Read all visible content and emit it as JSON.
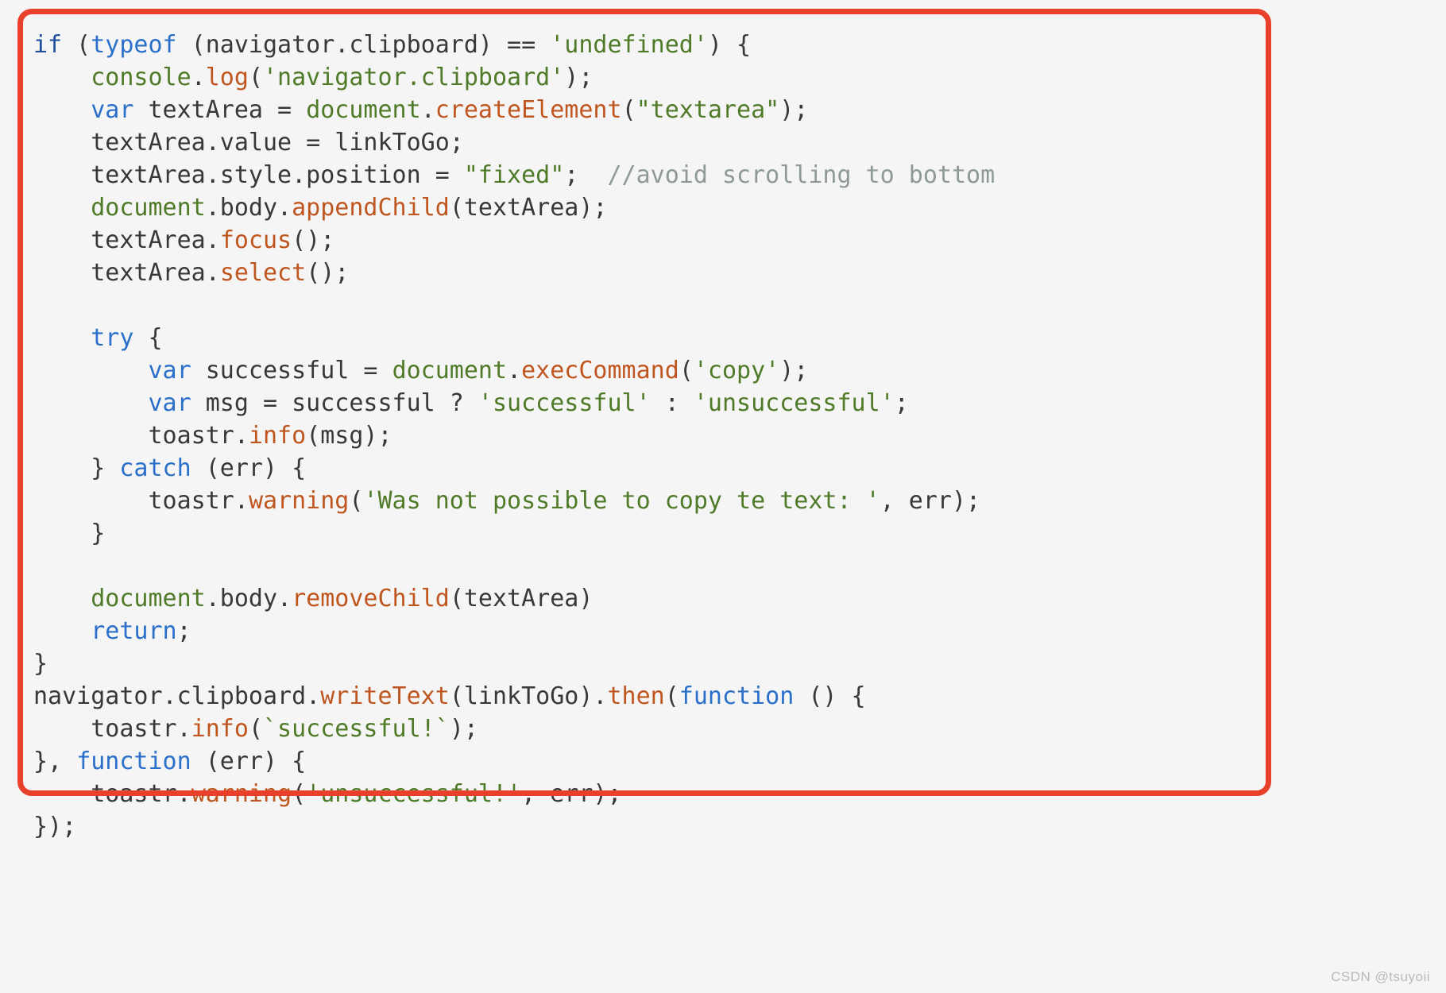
{
  "meta": {
    "background_color": "#f5f5f5",
    "highlight_border_color": "#e8402a",
    "language": "javascript"
  },
  "watermark": {
    "text": "CSDN @tsuyoii"
  },
  "annotation": {
    "name": "red-highlight-rectangle",
    "covers_lines": "1-22"
  },
  "palette": {
    "keyword": "#1f4f9c",
    "keyword_alt": "#2a6fc9",
    "object": "#4f7a28",
    "function": "#c0561f",
    "string": "#4f7a28",
    "comment": "#8e9a92",
    "plain": "#383838"
  },
  "code": {
    "full_text": "if (typeof (navigator.clipboard) == 'undefined') {\n    console.log('navigator.clipboard');\n    var textArea = document.createElement(\"textarea\");\n    textArea.value = linkToGo;\n    textArea.style.position = \"fixed\";  //avoid scrolling to bottom\n    document.body.appendChild(textArea);\n    textArea.focus();\n    textArea.select();\n\n    try {\n        var successful = document.execCommand('copy');\n        var msg = successful ? 'successful' : 'unsuccessful';\n        toastr.info(msg);\n    } catch (err) {\n        toastr.warning('Was not possible to copy te text: ', err);\n    }\n\n    document.body.removeChild(textArea)\n    return;\n}\nnavigator.clipboard.writeText(linkToGo).then(function () {\n    toastr.info(`successful!`);\n}, function (err) {\n    toastr.warning('unsuccessful!', err);\n});",
    "lines": [
      {
        "n": 1,
        "tokens": [
          {
            "t": "if",
            "c": "kw"
          },
          {
            "t": " (",
            "c": "plain"
          },
          {
            "t": "typeof",
            "c": "kw2"
          },
          {
            "t": " (navigator.clipboard) == ",
            "c": "plain"
          },
          {
            "t": "'undefined'",
            "c": "str"
          },
          {
            "t": ") {",
            "c": "plain"
          }
        ]
      },
      {
        "n": 2,
        "tokens": [
          {
            "t": "    ",
            "c": "plain"
          },
          {
            "t": "console",
            "c": "obj"
          },
          {
            "t": ".",
            "c": "plain"
          },
          {
            "t": "log",
            "c": "fn"
          },
          {
            "t": "(",
            "c": "plain"
          },
          {
            "t": "'navigator.clipboard'",
            "c": "str"
          },
          {
            "t": ");",
            "c": "plain"
          }
        ]
      },
      {
        "n": 3,
        "tokens": [
          {
            "t": "    ",
            "c": "plain"
          },
          {
            "t": "var",
            "c": "kw2"
          },
          {
            "t": " textArea = ",
            "c": "plain"
          },
          {
            "t": "document",
            "c": "obj"
          },
          {
            "t": ".",
            "c": "plain"
          },
          {
            "t": "createElement",
            "c": "fn"
          },
          {
            "t": "(",
            "c": "plain"
          },
          {
            "t": "\"textarea\"",
            "c": "str"
          },
          {
            "t": ");",
            "c": "plain"
          }
        ]
      },
      {
        "n": 4,
        "tokens": [
          {
            "t": "    textArea.value = linkToGo;",
            "c": "plain"
          }
        ]
      },
      {
        "n": 5,
        "tokens": [
          {
            "t": "    textArea.style.position = ",
            "c": "plain"
          },
          {
            "t": "\"fixed\"",
            "c": "str"
          },
          {
            "t": ";  ",
            "c": "plain"
          },
          {
            "t": "//avoid scrolling to bottom",
            "c": "cmt"
          }
        ]
      },
      {
        "n": 6,
        "tokens": [
          {
            "t": "    ",
            "c": "plain"
          },
          {
            "t": "document",
            "c": "obj"
          },
          {
            "t": ".body.",
            "c": "plain"
          },
          {
            "t": "appendChild",
            "c": "fn"
          },
          {
            "t": "(textArea);",
            "c": "plain"
          }
        ]
      },
      {
        "n": 7,
        "tokens": [
          {
            "t": "    textArea.",
            "c": "plain"
          },
          {
            "t": "focus",
            "c": "fn"
          },
          {
            "t": "();",
            "c": "plain"
          }
        ]
      },
      {
        "n": 8,
        "tokens": [
          {
            "t": "    textArea.",
            "c": "plain"
          },
          {
            "t": "select",
            "c": "fn"
          },
          {
            "t": "();",
            "c": "plain"
          }
        ]
      },
      {
        "n": 9,
        "tokens": []
      },
      {
        "n": 10,
        "tokens": [
          {
            "t": "    ",
            "c": "plain"
          },
          {
            "t": "try",
            "c": "kw2"
          },
          {
            "t": " {",
            "c": "plain"
          }
        ]
      },
      {
        "n": 11,
        "tokens": [
          {
            "t": "        ",
            "c": "plain"
          },
          {
            "t": "var",
            "c": "kw2"
          },
          {
            "t": " successful = ",
            "c": "plain"
          },
          {
            "t": "document",
            "c": "obj"
          },
          {
            "t": ".",
            "c": "plain"
          },
          {
            "t": "execCommand",
            "c": "fn"
          },
          {
            "t": "(",
            "c": "plain"
          },
          {
            "t": "'copy'",
            "c": "str"
          },
          {
            "t": ");",
            "c": "plain"
          }
        ]
      },
      {
        "n": 12,
        "tokens": [
          {
            "t": "        ",
            "c": "plain"
          },
          {
            "t": "var",
            "c": "kw2"
          },
          {
            "t": " msg = successful ? ",
            "c": "plain"
          },
          {
            "t": "'successful'",
            "c": "str"
          },
          {
            "t": " : ",
            "c": "plain"
          },
          {
            "t": "'unsuccessful'",
            "c": "str"
          },
          {
            "t": ";",
            "c": "plain"
          }
        ]
      },
      {
        "n": 13,
        "tokens": [
          {
            "t": "        toastr.",
            "c": "plain"
          },
          {
            "t": "info",
            "c": "fn"
          },
          {
            "t": "(msg);",
            "c": "plain"
          }
        ]
      },
      {
        "n": 14,
        "tokens": [
          {
            "t": "    } ",
            "c": "plain"
          },
          {
            "t": "catch",
            "c": "kw2"
          },
          {
            "t": " (err) {",
            "c": "plain"
          }
        ]
      },
      {
        "n": 15,
        "tokens": [
          {
            "t": "        toastr.",
            "c": "plain"
          },
          {
            "t": "warning",
            "c": "fn"
          },
          {
            "t": "(",
            "c": "plain"
          },
          {
            "t": "'Was not possible to copy te text: '",
            "c": "str"
          },
          {
            "t": ", err);",
            "c": "plain"
          }
        ]
      },
      {
        "n": 16,
        "tokens": [
          {
            "t": "    }",
            "c": "plain"
          }
        ]
      },
      {
        "n": 17,
        "tokens": []
      },
      {
        "n": 18,
        "tokens": [
          {
            "t": "    ",
            "c": "plain"
          },
          {
            "t": "document",
            "c": "obj"
          },
          {
            "t": ".body.",
            "c": "plain"
          },
          {
            "t": "removeChild",
            "c": "fn"
          },
          {
            "t": "(textArea)",
            "c": "plain"
          }
        ]
      },
      {
        "n": 19,
        "tokens": [
          {
            "t": "    ",
            "c": "plain"
          },
          {
            "t": "return",
            "c": "kw2"
          },
          {
            "t": ";",
            "c": "plain"
          }
        ]
      },
      {
        "n": 20,
        "tokens": [
          {
            "t": "}",
            "c": "plain"
          }
        ]
      },
      {
        "n": 21,
        "tokens": [
          {
            "t": "navigator.clipboard.",
            "c": "plain"
          },
          {
            "t": "writeText",
            "c": "fn"
          },
          {
            "t": "(linkToGo).",
            "c": "plain"
          },
          {
            "t": "then",
            "c": "fn"
          },
          {
            "t": "(",
            "c": "plain"
          },
          {
            "t": "function",
            "c": "kw2"
          },
          {
            "t": " () {",
            "c": "plain"
          }
        ]
      },
      {
        "n": 22,
        "tokens": [
          {
            "t": "    toastr.",
            "c": "plain"
          },
          {
            "t": "info",
            "c": "fn"
          },
          {
            "t": "(",
            "c": "plain"
          },
          {
            "t": "`successful!`",
            "c": "str"
          },
          {
            "t": ");",
            "c": "plain"
          }
        ]
      },
      {
        "n": 23,
        "tokens": [
          {
            "t": "}, ",
            "c": "plain"
          },
          {
            "t": "function",
            "c": "kw2"
          },
          {
            "t": " (err) {",
            "c": "plain"
          }
        ]
      },
      {
        "n": 24,
        "tokens": [
          {
            "t": "    toastr.",
            "c": "plain"
          },
          {
            "t": "warning",
            "c": "fn"
          },
          {
            "t": "(",
            "c": "plain"
          },
          {
            "t": "'unsuccessful!'",
            "c": "str"
          },
          {
            "t": ", err);",
            "c": "plain"
          }
        ]
      },
      {
        "n": 25,
        "tokens": [
          {
            "t": "});",
            "c": "plain"
          }
        ]
      }
    ]
  }
}
